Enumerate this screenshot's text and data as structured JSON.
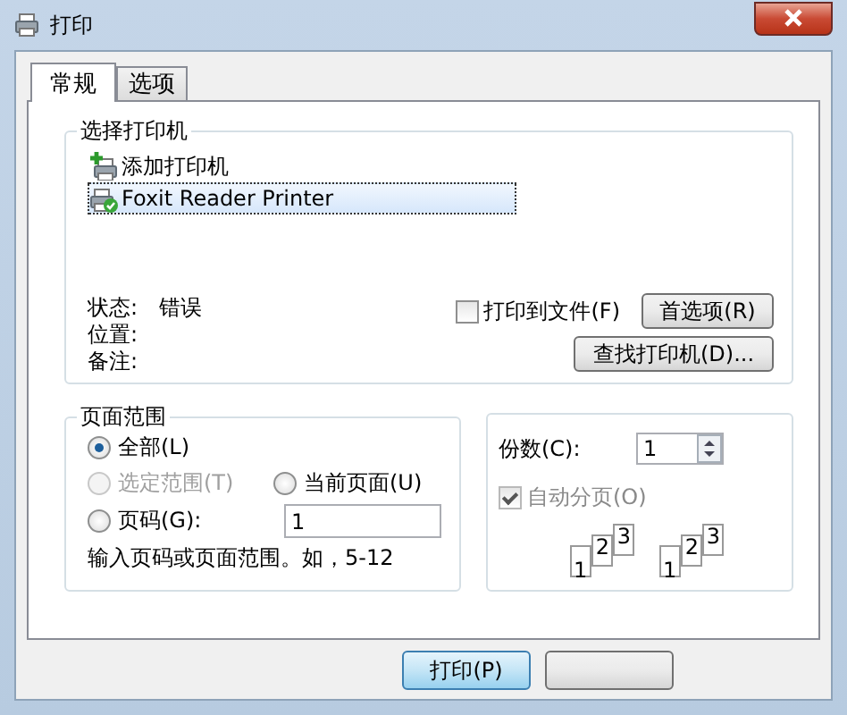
{
  "window": {
    "title": "打印"
  },
  "tabs": [
    {
      "label": "常规",
      "selected": true
    },
    {
      "label": "选项",
      "selected": false
    }
  ],
  "printer_group": {
    "title": "选择打印机",
    "printers": [
      {
        "name": "添加打印机",
        "kind": "add",
        "selected": false
      },
      {
        "name": "Foxit Reader Printer",
        "kind": "printer",
        "selected": true
      }
    ],
    "info": [
      {
        "label": "状态:",
        "value": "错误"
      },
      {
        "label": "位置:"
      },
      {
        "label": "备注:"
      }
    ],
    "print_to_file": {
      "label": "打印到文件(F)",
      "checked": false
    },
    "buttons": [
      "首选项(R)",
      "查找打印机(D)..."
    ]
  },
  "page_range": {
    "title": "页面范围",
    "options": [
      {
        "label": "全部(L)",
        "selected": true,
        "disabled": false
      },
      {
        "label": "选定范围(T)",
        "selected": false,
        "disabled": true
      },
      {
        "label": "当前页面(U)",
        "selected": false,
        "disabled": false
      },
      {
        "label": "页码(G):",
        "selected": false,
        "disabled": false
      }
    ],
    "pages_value": "1",
    "hint": "输入页码或页面范围。如，5-12"
  },
  "copies": {
    "label": "份数(C):",
    "value": "1",
    "collate": {
      "label": "自动分页(O)",
      "checked": true,
      "disabled": true
    },
    "collate_sets": [
      [
        "1",
        "2",
        "3"
      ],
      [
        "1",
        "2",
        "3"
      ]
    ]
  },
  "footer_buttons": [
    {
      "label": "打印(P)",
      "default": true
    },
    {
      "default": false
    }
  ]
}
